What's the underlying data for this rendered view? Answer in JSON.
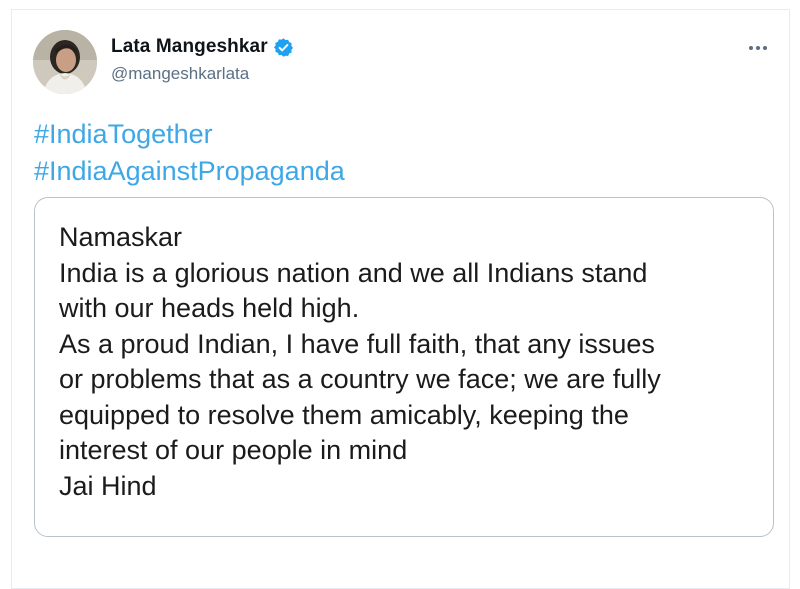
{
  "tweet": {
    "author": {
      "display_name": "Lata Mangeshkar",
      "handle": "@mangeshkarlata",
      "verified": true,
      "verified_icon": "verified-badge-icon",
      "avatar_icon": "profile-photo"
    },
    "menu_icon": "more-options-icon",
    "hashtags": [
      "#IndiaTogether",
      "#IndiaAgainstPropaganda"
    ],
    "statement_lines": [
      "Namaskar",
      "India is a glorious nation and we all Indians stand",
      "with our heads held high.",
      "As a proud Indian, I have full faith, that any issues",
      "or problems that as a country we face; we are fully",
      "equipped to resolve them amicably, keeping the",
      "interest of our people in mind",
      "Jai Hind"
    ]
  },
  "colors": {
    "hashtag": "#3ea7e6",
    "verified_badge": "#1da1f2",
    "handle_gray": "#5b7083",
    "border": "#b8c2cc"
  }
}
